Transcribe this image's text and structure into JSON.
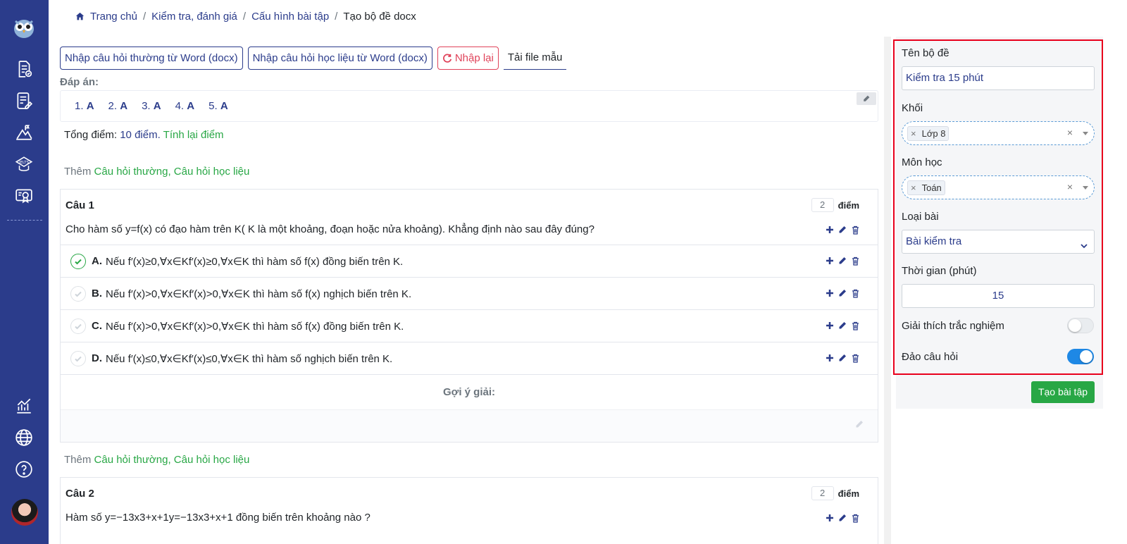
{
  "breadcrumb": [
    "Trang chủ",
    "Kiểm tra, đánh giá",
    "Cấu hình bài tập",
    "Tạo bộ đề docx"
  ],
  "toolbar": {
    "import_normal": "Nhập câu hỏi thường từ Word (docx)",
    "import_material": "Nhập câu hỏi học liệu từ Word (docx)",
    "reset": "Nhập lại",
    "download_template": "Tải file mẫu"
  },
  "answers": {
    "label": "Đáp án:",
    "items": [
      {
        "num": "1.",
        "val": "A"
      },
      {
        "num": "2.",
        "val": "A"
      },
      {
        "num": "3.",
        "val": "A"
      },
      {
        "num": "4.",
        "val": "A"
      },
      {
        "num": "5.",
        "val": "A"
      }
    ]
  },
  "score": {
    "prefix": "Tổng điểm:",
    "value": "10 điểm.",
    "recalc": "Tính lại điểm"
  },
  "add": {
    "prefix": "Thêm",
    "links": "Câu hỏi thường, Câu hỏi học liệu"
  },
  "questions": [
    {
      "title": "Câu 1",
      "points": "2",
      "points_unit": "điểm",
      "text": "Cho hàm số y=f(x) có đạo hàm trên K( K là một khoảng, đoạn hoặc nửa khoảng). Khẳng định nào sau đây đúng?",
      "options": [
        {
          "key": "A.",
          "text": "Nếu f′(x)≥0,∀x∈Kf′(x)≥0,∀x∈K thì hàm số f(x) đồng biến trên K.",
          "correct": true
        },
        {
          "key": "B.",
          "text": "Nếu f′(x)>0,∀x∈Kf′(x)>0,∀x∈K thì hàm số f(x) nghịch biến trên K.",
          "correct": false
        },
        {
          "key": "C.",
          "text": "Nếu f′(x)>0,∀x∈Kf′(x)>0,∀x∈K thì hàm số f(x) đồng biến trên K.",
          "correct": false
        },
        {
          "key": "D.",
          "text": "Nếu f′(x)≤0,∀x∈Kf′(x)≤0,∀x∈K thì hàm số nghịch biến trên K.",
          "correct": false
        }
      ],
      "hint_label": "Gợi ý giải:"
    },
    {
      "title": "Câu 2",
      "points": "2",
      "points_unit": "điểm",
      "text": "Hàm số y=−13x3+x+1y=−13x3+x+1 đồng biến trên khoảng nào ?"
    }
  ],
  "form": {
    "name_label": "Tên bộ đề",
    "name_value": "Kiểm tra 15 phút",
    "grade_label": "Khối",
    "grade_tag": "Lớp 8",
    "subject_label": "Môn học",
    "subject_tag": "Toán",
    "type_label": "Loại bài",
    "type_value": "Bài kiểm tra",
    "time_label": "Thời gian (phút)",
    "time_value": "15",
    "explain_label": "Giải thích trắc nghiệm",
    "explain_on": false,
    "shuffle_label": "Đảo câu hỏi",
    "shuffle_on": true,
    "submit": "Tạo bài tập"
  },
  "colors": {
    "sidebar": "#2b3c8b",
    "primary": "#2b3c8b",
    "success": "#28a745",
    "danger": "#e0435a",
    "highlight": "#e8001c"
  }
}
